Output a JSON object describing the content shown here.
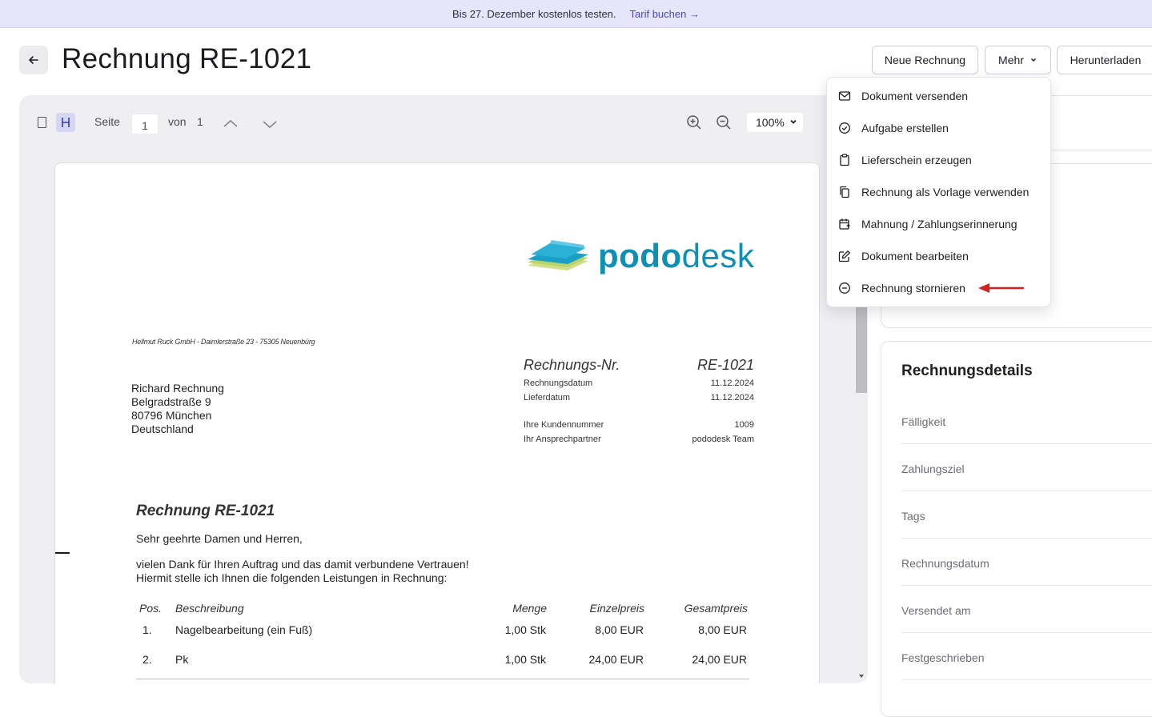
{
  "banner": {
    "text": "Bis 27. Dezember kostenlos testen.",
    "link": "Tarif buchen →"
  },
  "header": {
    "title": "Rechnung RE-1021",
    "back_icon": "arrow-left-icon",
    "new_invoice": "Neue Rechnung",
    "more": "Mehr",
    "download": "Herunterladen"
  },
  "viewer": {
    "page_label": "Seite",
    "page_value": "1",
    "of_label": "von",
    "total_pages": "1",
    "zoom": "100%",
    "icons": [
      "single-page-icon",
      "scroll-mode-icon",
      "chevron-up-icon",
      "chevron-down-icon",
      "zoom-in-icon",
      "zoom-out-icon"
    ]
  },
  "document": {
    "logo_part1": "podo",
    "logo_part2": "desk",
    "sender_line": "Hellmut Ruck GmbH - Daimlerstraße 23 - 75305 Neuenbürg",
    "recipient": [
      "Richard Rechnung",
      "Belgradstraße 9",
      "80796 München",
      "Deutschland"
    ],
    "meta_head_label": "Rechnungs-Nr.",
    "meta_head_value": "RE-1021",
    "meta_rows": [
      {
        "label": "Rechnungsdatum",
        "value": "11.12.2024"
      },
      {
        "label": "Lieferdatum",
        "value": "11.12.2024"
      },
      {
        "label": "Ihre Kundennummer",
        "value": "1009"
      },
      {
        "label": "Ihr Ansprechpartner",
        "value": "pododesk Team"
      }
    ],
    "invoice_title": "Rechnung RE-1021",
    "greeting": "Sehr geehrte Damen und Herren,",
    "intro_line1": "vielen Dank für Ihren Auftrag und das damit verbundene Vertrauen!",
    "intro_line2": "Hiermit stelle ich Ihnen die folgenden Leistungen in Rechnung:",
    "table_headers": {
      "pos": "Pos.",
      "desc": "Beschreibung",
      "qty": "Menge",
      "unit": "Einzelpreis",
      "total": "Gesamtpreis"
    },
    "table_rows": [
      {
        "pos": "1.",
        "desc": "Nagelbearbeitung (ein Fuß)",
        "qty": "1,00 Stk",
        "unit": "8,00 EUR",
        "total": "8,00 EUR"
      },
      {
        "pos": "2.",
        "desc": "Pk",
        "qty": "1,00 Stk",
        "unit": "24,00 EUR",
        "total": "24,00 EUR"
      }
    ]
  },
  "menu": {
    "items": [
      {
        "label": "Dokument versenden",
        "icon": "mail-icon"
      },
      {
        "label": "Aufgabe erstellen",
        "icon": "check-circle-icon"
      },
      {
        "label": "Lieferschein erzeugen",
        "icon": "clipboard-icon"
      },
      {
        "label": "Rechnung als Vorlage verwenden",
        "icon": "copy-icon"
      },
      {
        "label": "Mahnung / Zahlungserinnerung",
        "icon": "calendar-reminder-icon"
      },
      {
        "label": "Dokument bearbeiten",
        "icon": "edit-icon"
      },
      {
        "label": "Rechnung stornieren",
        "icon": "minus-circle-icon"
      }
    ]
  },
  "details": {
    "title": "Rechnungsdetails",
    "rows": [
      "Fälligkeit",
      "Zahlungsziel",
      "Tags",
      "Rechnungsdatum",
      "Versendet am",
      "Festgeschrieben"
    ]
  },
  "colors": {
    "accent": "#4b48c9",
    "banner_bg": "#e6e5fa",
    "logo_blue": "#0e8fb4",
    "annotation_red": "#d6201f"
  }
}
